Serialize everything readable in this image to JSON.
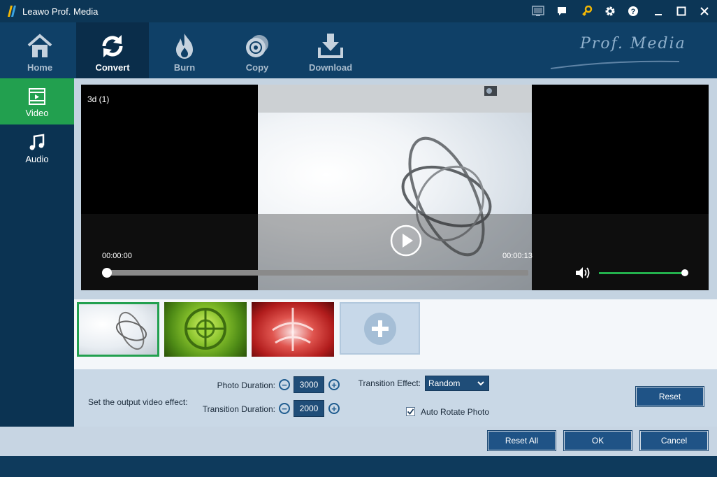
{
  "window": {
    "title": "Leawo Prof. Media"
  },
  "titlebar_buttons": [
    {
      "name": "screen-icon"
    },
    {
      "name": "chat-icon"
    },
    {
      "name": "key-icon"
    },
    {
      "name": "gear-icon"
    },
    {
      "name": "help-icon"
    },
    {
      "name": "minimize-icon"
    },
    {
      "name": "maximize-icon"
    },
    {
      "name": "close-icon"
    }
  ],
  "nav": {
    "items": [
      {
        "label": "Home",
        "icon": "home-icon"
      },
      {
        "label": "Convert",
        "icon": "convert-icon",
        "active": true
      },
      {
        "label": "Burn",
        "icon": "burn-icon"
      },
      {
        "label": "Copy",
        "icon": "copy-icon"
      },
      {
        "label": "Download",
        "icon": "download-icon"
      }
    ],
    "brand": "Prof. Media"
  },
  "sidebar": {
    "items": [
      {
        "label": "Video",
        "icon": "video-icon",
        "active": true
      },
      {
        "label": "Audio",
        "icon": "music-icon"
      }
    ]
  },
  "player": {
    "clip_name": "3d (1)",
    "current_time": "00:00:00",
    "total_time": "00:00:13",
    "progress": 0,
    "volume": 1.0
  },
  "thumbnails": [
    {
      "name": "thumbnail-1",
      "selected": true
    },
    {
      "name": "thumbnail-2",
      "selected": false
    },
    {
      "name": "thumbnail-3",
      "selected": false
    }
  ],
  "settings": {
    "label": "Set the output video effect:",
    "photo_duration": {
      "label": "Photo Duration:",
      "value": "3000"
    },
    "transition_duration": {
      "label": "Transition Duration:",
      "value": "2000"
    },
    "transition_effect": {
      "label": "Transition Effect:",
      "value": "Random"
    },
    "auto_rotate": {
      "label": "Auto Rotate Photo",
      "checked": true
    },
    "reset_label": "Reset"
  },
  "footer": {
    "reset_all_label": "Reset All",
    "ok_label": "OK",
    "cancel_label": "Cancel"
  },
  "colors": {
    "accent_green": "#22a04f",
    "nav_bg": "#0f4067",
    "button_blue": "#1f5386"
  }
}
